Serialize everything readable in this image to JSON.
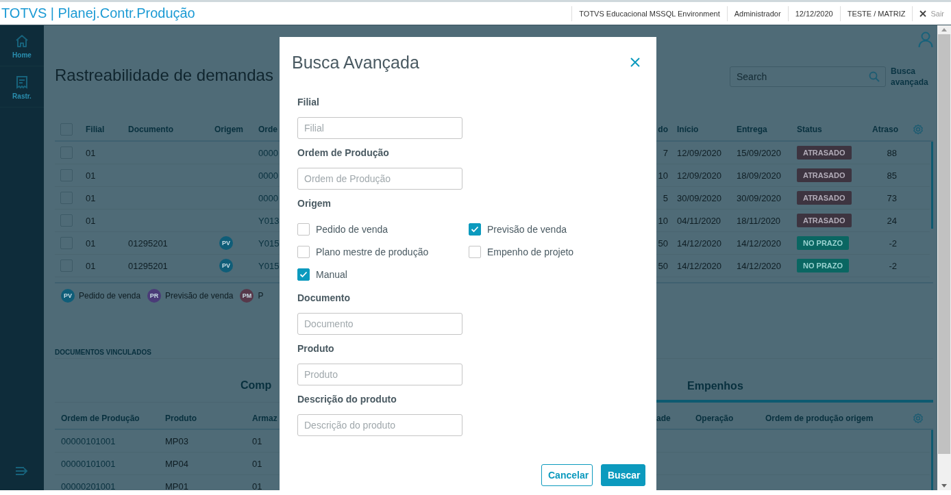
{
  "app_bar": {
    "title": "TOTVS | Planej.Contr.Produção",
    "items": [
      "TOTVS Educacional MSSQL Environment",
      "Administrador",
      "12/12/2020",
      "TESTE / MATRIZ"
    ],
    "logout": "Sair"
  },
  "sidebar": {
    "items": [
      {
        "label": "Home"
      },
      {
        "label": "Rastr."
      }
    ]
  },
  "page": {
    "title": "Rastreabilidade de demandas",
    "search": {
      "placeholder": "Search"
    },
    "advanced_search_link": "Busca avançada"
  },
  "demands_table": {
    "select_all_checked": false,
    "columns_left": [
      "Filial",
      "Documento",
      "Origem",
      "Orde"
    ],
    "columns_right": [
      "do",
      "Início",
      "Entrega",
      "Status",
      "Atraso"
    ],
    "rows": [
      {
        "checked": false,
        "filial": "01",
        "order": "0000",
        "column_5": "7",
        "inicio": "12/09/2020",
        "entrega": "15/09/2020",
        "status": {
          "label": "ATRASADO",
          "kind": "late"
        },
        "atraso": "88"
      },
      {
        "checked": false,
        "filial": "01",
        "order": "0000",
        "column_5": "10",
        "inicio": "12/09/2020",
        "entrega": "18/09/2020",
        "status": {
          "label": "ATRASADO",
          "kind": "late"
        },
        "atraso": "85"
      },
      {
        "checked": false,
        "filial": "01",
        "order": "0000",
        "column_5": "5",
        "inicio": "30/09/2020",
        "entrega": "30/09/2020",
        "status": {
          "label": "ATRASADO",
          "kind": "late"
        },
        "atraso": "73"
      },
      {
        "checked": false,
        "filial": "01",
        "order": "Y013",
        "column_5": "10",
        "inicio": "04/11/2020",
        "entrega": "18/11/2020",
        "status": {
          "label": "ATRASADO",
          "kind": "late"
        },
        "atraso": "24"
      },
      {
        "checked": false,
        "filial": "01",
        "documento": "01295201",
        "origem": {
          "code": "PV",
          "color": "#0f5d78"
        },
        "order": "Y015",
        "column_5": "50",
        "inicio": "14/12/2020",
        "entrega": "14/12/2020",
        "status": {
          "label": "NO PRAZO",
          "kind": "on_time"
        },
        "atraso": "-2"
      },
      {
        "checked": false,
        "filial": "01",
        "documento": "01295201",
        "origem": {
          "code": "PV",
          "color": "#0f5d78"
        },
        "order": "Y015",
        "column_5": "50",
        "inicio": "14/12/2020",
        "entrega": "14/12/2020",
        "status": {
          "label": "NO PRAZO",
          "kind": "on_time"
        },
        "atraso": "-2"
      }
    ]
  },
  "legend": [
    {
      "code": "PV",
      "label": "Pedido de venda",
      "color": "#0f5d78"
    },
    {
      "code": "PR",
      "label": "Previsão de venda",
      "color": "#4a3b78"
    },
    {
      "code": "PM",
      "label": "P",
      "color": "#57384a"
    }
  ],
  "linked_documents": {
    "title": "DOCUMENTOS VINCULADOS",
    "tabs": [
      {
        "label": "Comp",
        "selected": false
      },
      {
        "label": "Empenhos",
        "selected": true
      }
    ],
    "columns_left": [
      "Ordem de Produção",
      "Produto",
      "Armaz"
    ],
    "columns_right": [
      "ade",
      "Operação",
      "Ordem de produção origem"
    ],
    "rows": [
      [
        "00000101001",
        "MP03",
        "01"
      ],
      [
        "00000101001",
        "MP04",
        "01"
      ],
      [
        "00000201001",
        "MP01",
        "01"
      ]
    ]
  },
  "dialog": {
    "title": "Busca Avançada",
    "items": [
      {
        "kind": "input",
        "label": "Filial",
        "placeholder": "Filial"
      },
      {
        "kind": "input",
        "label": "Ordem de Produção",
        "placeholder": "Ordem de Produção"
      },
      {
        "kind": "checks",
        "label": "Origem",
        "options": [
          {
            "label": "Pedido de venda",
            "checked": false
          },
          {
            "label": "Previsão de venda",
            "checked": true
          },
          {
            "label": "Plano mestre de produção",
            "checked": false
          },
          {
            "label": "Empenho de projeto",
            "checked": false
          },
          {
            "label": "Manual",
            "checked": true
          }
        ]
      },
      {
        "kind": "input",
        "label": "Documento",
        "placeholder": "Documento"
      },
      {
        "kind": "input",
        "label": "Produto",
        "placeholder": "Produto"
      },
      {
        "kind": "input",
        "label": "Descrição do produto",
        "placeholder": "Descrição do produto"
      }
    ],
    "buttons": [
      {
        "label": "Cancelar",
        "kind": "secondary"
      },
      {
        "label": "Buscar",
        "kind": "primary"
      }
    ]
  }
}
